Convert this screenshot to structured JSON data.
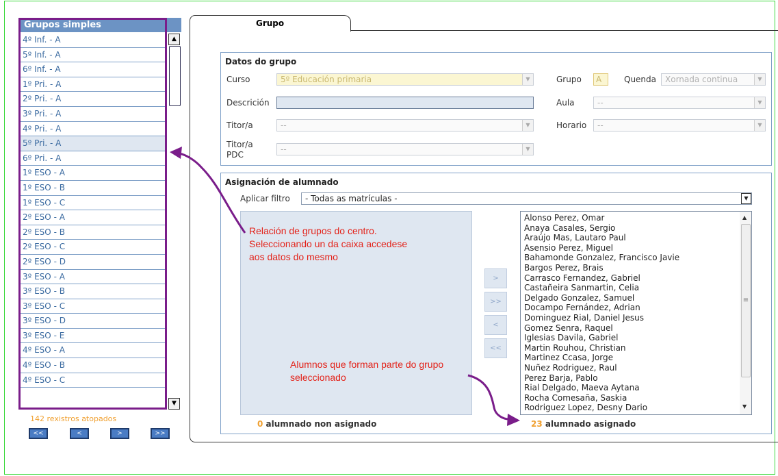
{
  "groups_panel": {
    "header": "Grupos simples",
    "items": [
      "4º Inf. - A",
      "5º Inf. - A",
      "6º Inf. - A",
      "1º Pri. - A",
      "2º Pri. - A",
      "3º Pri. - A",
      "4º Pri. - A",
      "5º Pri. - A",
      "6º Pri. - A",
      "1º ESO - A",
      "1º ESO - B",
      "1º ESO - C",
      "2º ESO - A",
      "2º ESO - B",
      "2º ESO - C",
      "2º ESO - D",
      "3º ESO - A",
      "3º ESO - B",
      "3º ESO - C",
      "3º ESO - D",
      "3º ESO - E",
      "4º ESO - A",
      "4º ESO - B",
      "4º ESO - C"
    ],
    "selected_index": 7,
    "record_count": "142 rexistros atopados",
    "pager": {
      "first": "<<",
      "prev": "<",
      "next": ">",
      "last": ">>"
    }
  },
  "tab": {
    "label": "Grupo"
  },
  "datos": {
    "legend": "Datos do grupo",
    "curso_label": "Curso",
    "curso_value": "5º Educación primaria",
    "grupo_label": "Grupo",
    "grupo_value": "A",
    "quenda_label": "Quenda",
    "quenda_value": "Xornada continua",
    "descricion_label": "Descrición",
    "aula_label": "Aula",
    "aula_value": "--",
    "titor_label": "Titor/a",
    "titor_value": "--",
    "horario_label": "Horario",
    "horario_value": "--",
    "titor_pdc_label": "Titor/a PDC",
    "titor_pdc_value": "--"
  },
  "asignacion": {
    "legend": "Asignación de alumnado",
    "filter_label": "Aplicar filtro",
    "filter_value": "- Todas as matrículas -",
    "buttons": {
      "add": ">",
      "add_all": ">>",
      "remove": "<",
      "remove_all": "<<"
    },
    "assigned": [
      "Alonso Perez, Omar",
      "Anaya Casales, Sergio",
      "Araújo Mas, Lautaro Paul",
      "Asensio Perez, Miguel",
      "Bahamonde Gonzalez, Francisco Javie",
      "Bargos Perez, Brais",
      "Carrasco Fernandez, Gabriel",
      "Castañeira Sanmartin, Celia",
      "Delgado Gonzalez, Samuel",
      "Docampo Fernández, Adrian",
      "Dominguez Rial, Daniel Jesus",
      "Gomez Senra, Raquel",
      "Iglesias Davila, Gabriel",
      "Martin Rouhou, Christian",
      "Martinez Ccasa, Jorge",
      "Nuñez Rodriguez, Raul",
      "Perez Barja, Pablo",
      "Rial Delgado, Maeva Aytana",
      "Rocha Comesaña, Saskia",
      "Rodriguez Lopez, Desny Dario"
    ],
    "unassigned_count": "0",
    "unassigned_label": "alumnado non asignado",
    "assigned_count": "23",
    "assigned_label": "alumnado asignado"
  },
  "annotations": {
    "groups_note": "Relación de grupos do centro.\nSeleccionando un da caixa accedese\naos datos do mesmo",
    "students_note": "Alumnos que forman parte do grupo\nseleccionado"
  },
  "colors": {
    "accent": "#6c93c4",
    "highlight": "#7a1d8a",
    "annotation": "#e32219",
    "count": "#f0a030"
  }
}
